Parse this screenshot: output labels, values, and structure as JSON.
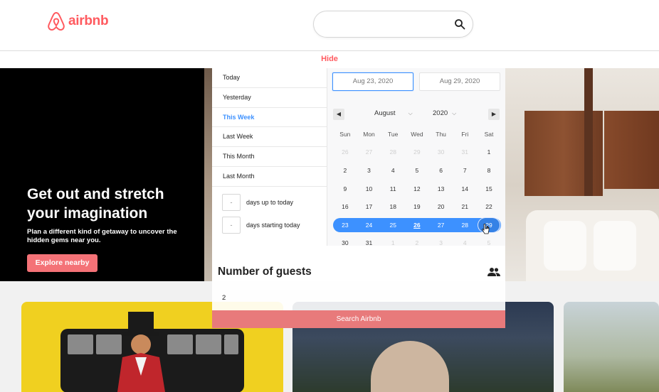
{
  "brand": {
    "name": "airbnb",
    "color": "#ff5a5f"
  },
  "search": {
    "value": "",
    "placeholder": ""
  },
  "hide_label": "Hide",
  "hero": {
    "title": "Get out and stretch your imagination",
    "subtitle": "Plan a different kind of getaway to uncover the hidden gems near you.",
    "cta": "Explore nearby"
  },
  "quick_ranges": {
    "items": [
      "Today",
      "Yesterday",
      "This Week",
      "Last Week",
      "This Month",
      "Last Month"
    ],
    "active": "This Week",
    "relative": [
      {
        "value": "-",
        "label": "days up to today"
      },
      {
        "value": "-",
        "label": "days starting today"
      }
    ]
  },
  "calendar": {
    "start_date": "Aug 23, 2020",
    "end_date": "Aug 29, 2020",
    "month": "August",
    "year": "2020",
    "weekdays": [
      "Sun",
      "Mon",
      "Tue",
      "Wed",
      "Thu",
      "Fri",
      "Sat"
    ],
    "weeks": [
      [
        "26",
        "27",
        "28",
        "29",
        "30",
        "31",
        "1"
      ],
      [
        "2",
        "3",
        "4",
        "5",
        "6",
        "7",
        "8"
      ],
      [
        "9",
        "10",
        "11",
        "12",
        "13",
        "14",
        "15"
      ],
      [
        "16",
        "17",
        "18",
        "19",
        "20",
        "21",
        "22"
      ],
      [
        "23",
        "24",
        "25",
        "26",
        "27",
        "28",
        "29"
      ],
      [
        "30",
        "31",
        "1",
        "2",
        "3",
        "4",
        "5"
      ]
    ],
    "highlight_color": "#3d91ff"
  },
  "guests": {
    "title": "Number of guests",
    "value": "2"
  },
  "search_button": "Search Airbnb"
}
